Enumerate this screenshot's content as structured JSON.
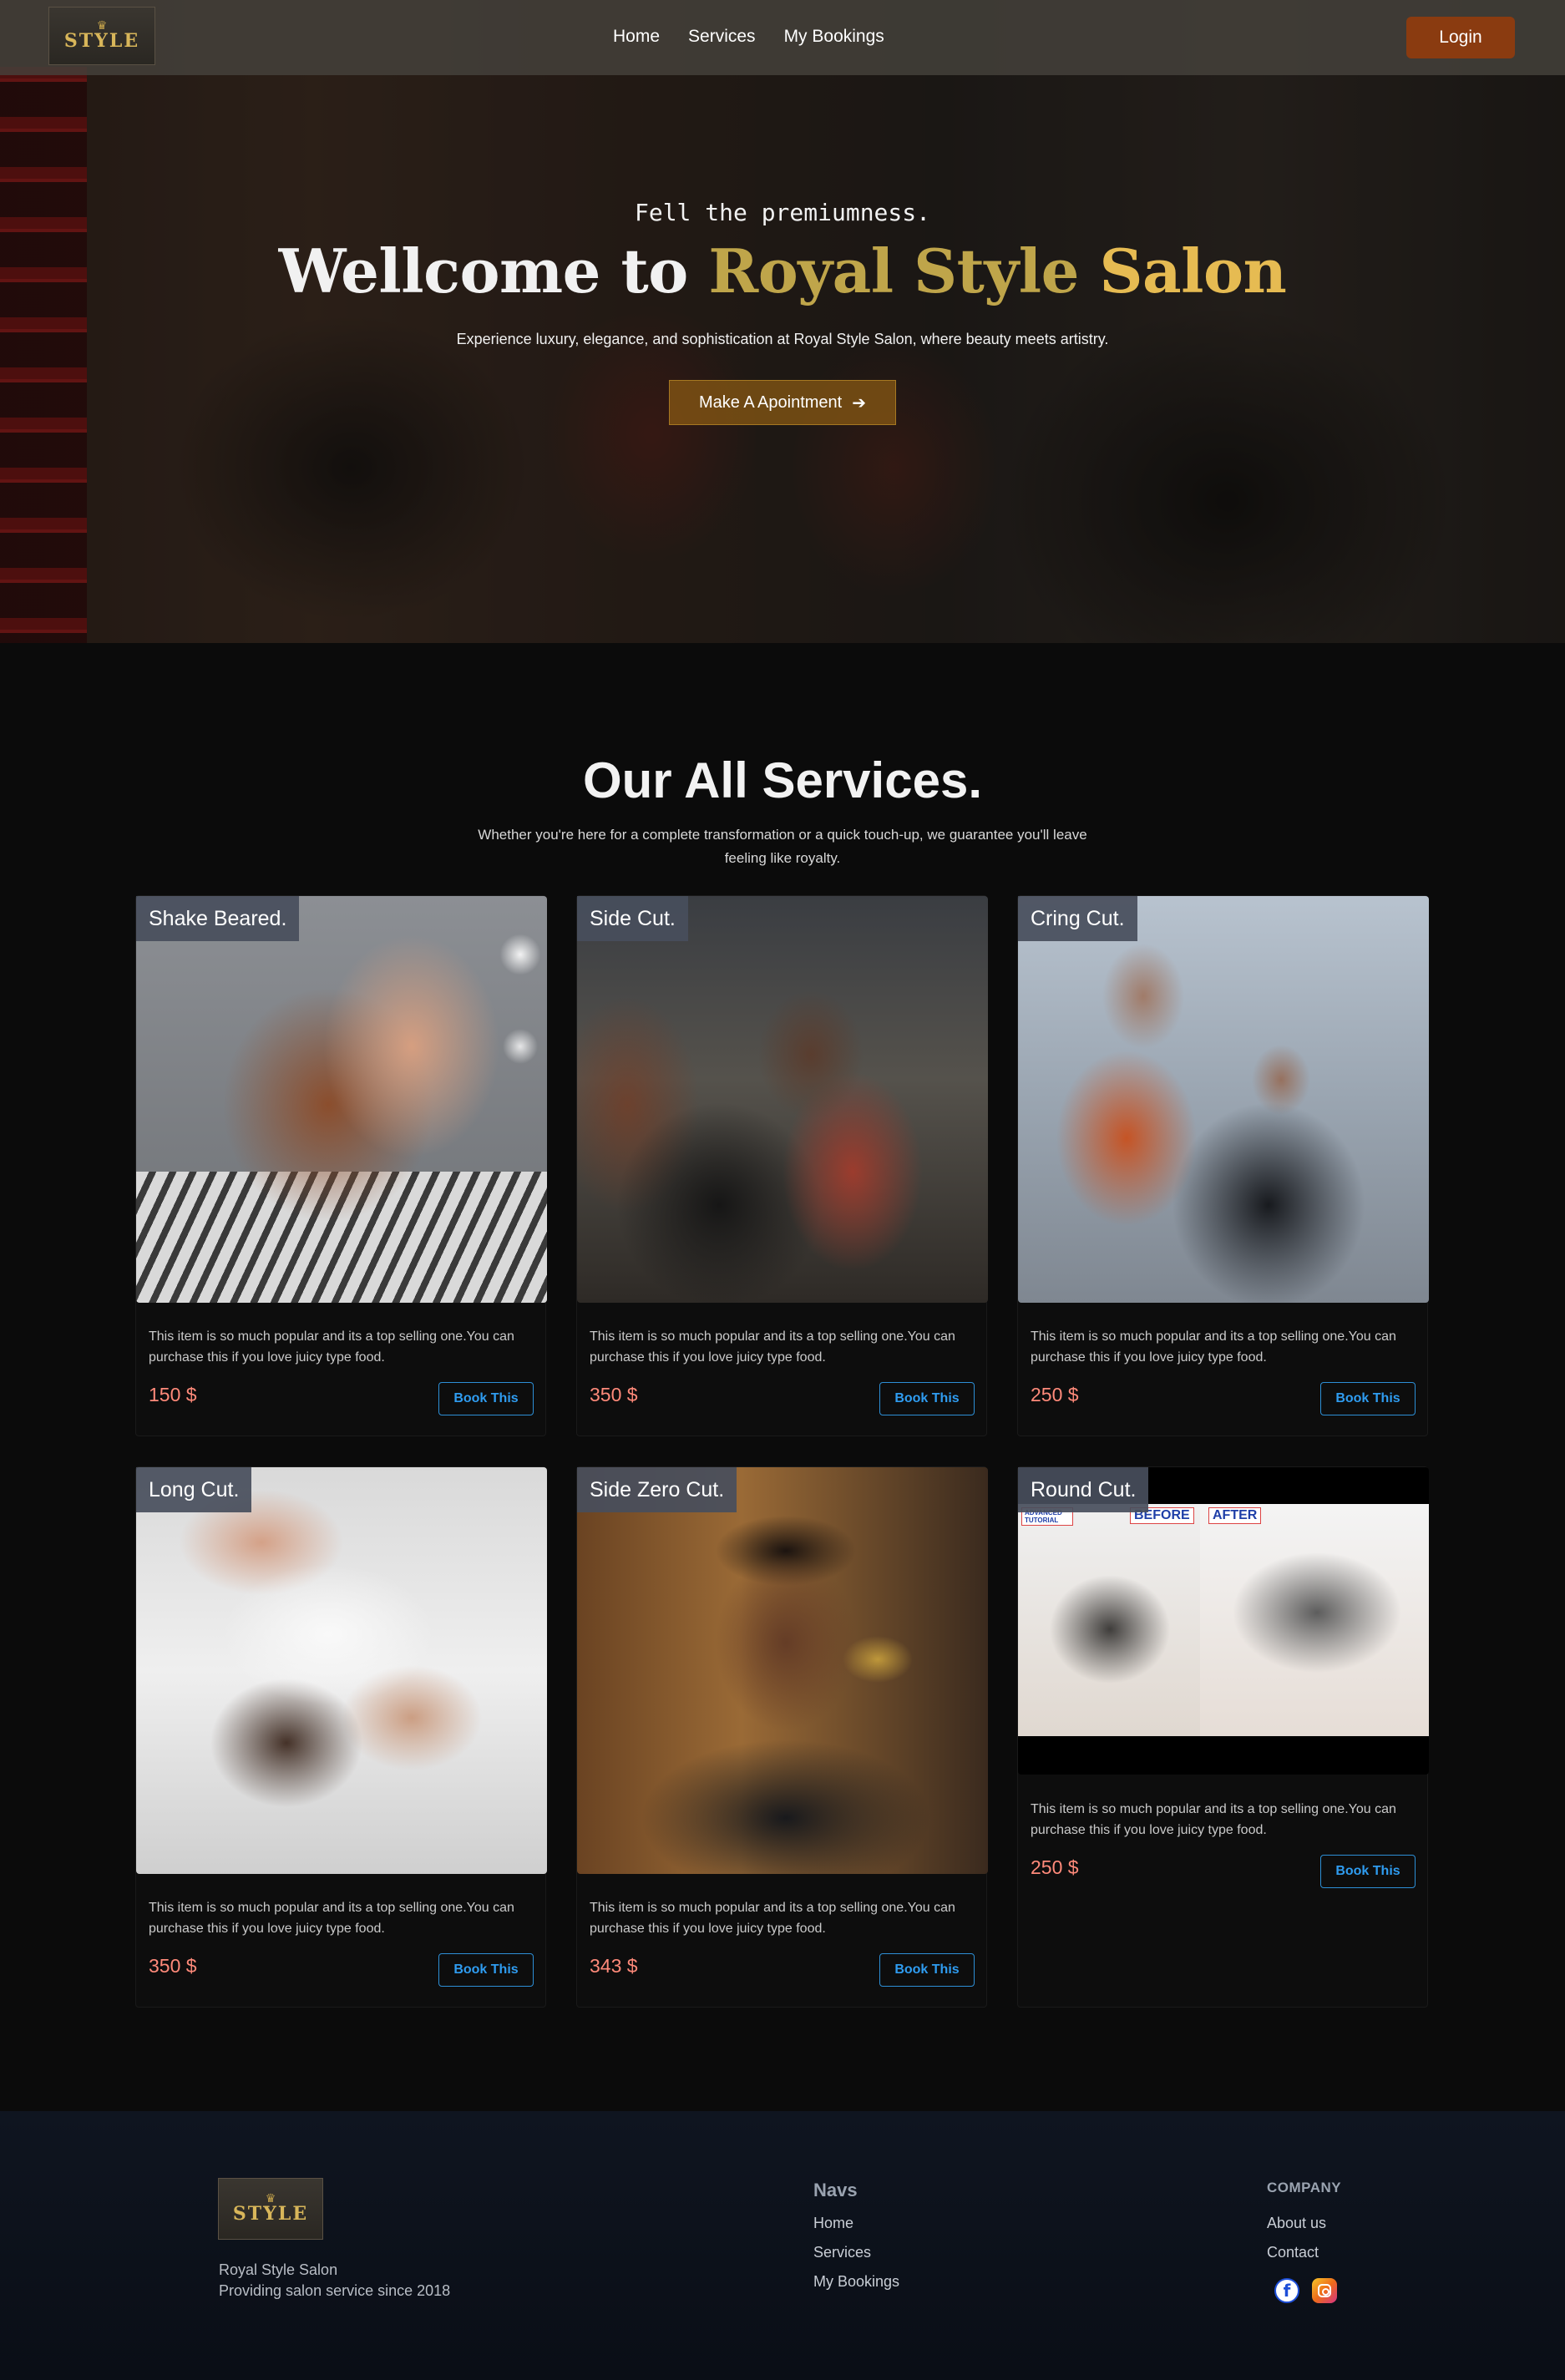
{
  "navbar": {
    "logo_text": "STYLE",
    "links": [
      "Home",
      "Services",
      "My Bookings"
    ],
    "login_label": "Login"
  },
  "hero": {
    "tagline": "Fell the premiumness.",
    "title_part1": "Wellcome to",
    "title_part2": "Royal Style",
    "title_part3": "Salon",
    "subtitle": "Experience luxury, elegance, and sophistication at Royal Style Salon, where beauty meets artistry.",
    "cta_label": "Make A Apointment",
    "cta_icon": "arrow-right-icon"
  },
  "services": {
    "title": "Our All Services.",
    "subtitle": "Whether you're here for a complete transformation or a quick touch-up, we guarantee you'll leave feeling like royalty.",
    "book_label": "Book This",
    "items": [
      {
        "name": "Shake Beared.",
        "description": "This item is so much popular and its a top selling one.You can purchase this if you love juicy type food.",
        "price": "150 $"
      },
      {
        "name": "Side Cut.",
        "description": "This item is so much popular and its a top selling one.You can purchase this if you love juicy type food.",
        "price": "350 $"
      },
      {
        "name": "Cring Cut.",
        "description": "This item is so much popular and its a top selling one.You can purchase this if you love juicy type food.",
        "price": "250 $"
      },
      {
        "name": "Long Cut.",
        "description": "This item is so much popular and its a top selling one.You can purchase this if you love juicy type food.",
        "price": "350 $"
      },
      {
        "name": "Side Zero Cut.",
        "description": "This item is so much popular and its a top selling one.You can purchase this if you love juicy type food.",
        "price": "343 $"
      },
      {
        "name": "Round Cut.",
        "description": "This item is so much popular and its a top selling one.You can purchase this if you love juicy type food.",
        "price": "250 $",
        "image_labels": {
          "tag": "ADVANCED TUTORIAL",
          "before": "BEFORE",
          "after": "AFTER"
        }
      }
    ]
  },
  "footer": {
    "logo_text": "STYLE",
    "brand_name": "Royal Style Salon",
    "brand_tagline": "Providing salon service since 2018",
    "navs_title": "Navs",
    "navs_links": [
      "Home",
      "Services",
      "My Bookings"
    ],
    "company_title": "COMPANY",
    "company_links": [
      "About us",
      "Contact"
    ],
    "social_icons": [
      "facebook-icon",
      "instagram-icon"
    ]
  },
  "colors": {
    "accent_gold": "#e6bb52",
    "login_bg": "#8a3b10",
    "price": "#ff8a7a",
    "book_button": "#2f9cf0"
  }
}
